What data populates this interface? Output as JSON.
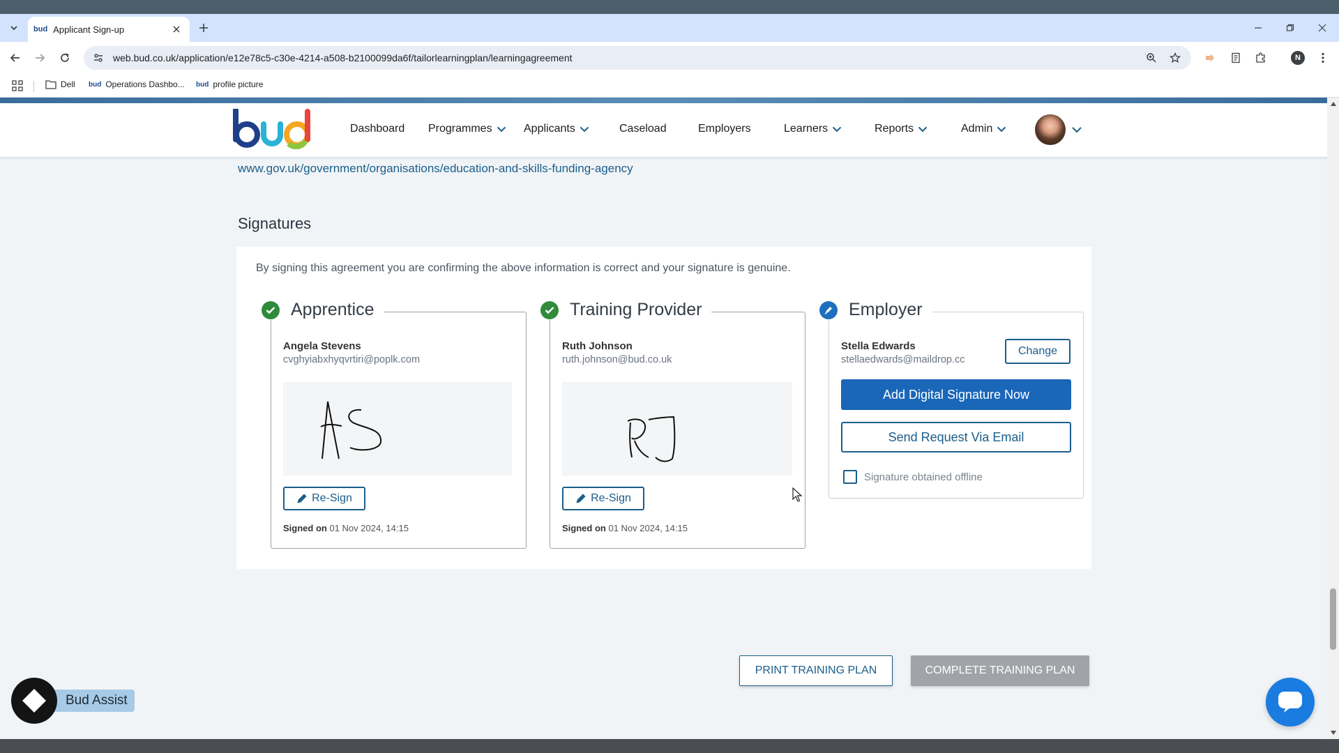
{
  "browser": {
    "tab_title": "Applicant Sign-up",
    "tab_favicon": "bud",
    "url_host": "web.bud.co.uk",
    "url_path": "/application/e12e78c5-c30e-4214-a508-b2100099da6f/tailorlearningplan/learningagreement",
    "profile_initial": "N",
    "bookmarks": [
      {
        "label": "Dell",
        "icon": "folder-icon"
      },
      {
        "label": "Operations Dashbo...",
        "icon": "bud-favicon"
      },
      {
        "label": "profile picture",
        "icon": "bud-favicon"
      }
    ]
  },
  "app": {
    "logo_text": "bud",
    "nav": [
      {
        "label": "Dashboard",
        "has_menu": false
      },
      {
        "label": "Programmes",
        "has_menu": true
      },
      {
        "label": "Applicants",
        "has_menu": true
      },
      {
        "label": "Caseload",
        "has_menu": false
      },
      {
        "label": "Employers",
        "has_menu": false
      },
      {
        "label": "Learners",
        "has_menu": true
      },
      {
        "label": "Reports",
        "has_menu": true
      },
      {
        "label": "Admin",
        "has_menu": true
      }
    ]
  },
  "content": {
    "gov_link": "www.gov.uk/government/organisations/education-and-skills-funding-agency",
    "signatures_heading": "Signatures",
    "intro": "By signing this agreement you are confirming the above information is correct and your signature is genuine.",
    "cards": {
      "apprentice": {
        "title": "Apprentice",
        "status": "signed",
        "name": "Angela Stevens",
        "email": "cvghyiabxhyqvrtiri@poplk.com",
        "resign_label": "Re-Sign",
        "signed_on_label": "Signed on",
        "signed_on_value": "01 Nov 2024, 14:15"
      },
      "provider": {
        "title": "Training Provider",
        "status": "signed",
        "name": "Ruth Johnson",
        "email": "ruth.johnson@bud.co.uk",
        "resign_label": "Re-Sign",
        "signed_on_label": "Signed on",
        "signed_on_value": "01 Nov 2024, 14:15"
      },
      "employer": {
        "title": "Employer",
        "status": "pending",
        "name": "Stella Edwards",
        "email": "stellaedwards@maildrop.cc",
        "change_label": "Change",
        "add_signature_label": "Add Digital Signature Now",
        "send_request_label": "Send Request Via Email",
        "offline_label": "Signature obtained offline"
      }
    },
    "print_label": "PRINT TRAINING PLAN",
    "complete_label": "COMPLETE TRAINING PLAN"
  },
  "assist": {
    "label": "Bud Assist"
  },
  "colors": {
    "primary": "#1a5e8a",
    "primary_fill": "#1a66b8",
    "success": "#2e8b3a",
    "pending": "#1e6fbf",
    "disabled": "#a0a4a8",
    "chat": "#1a7be0"
  }
}
